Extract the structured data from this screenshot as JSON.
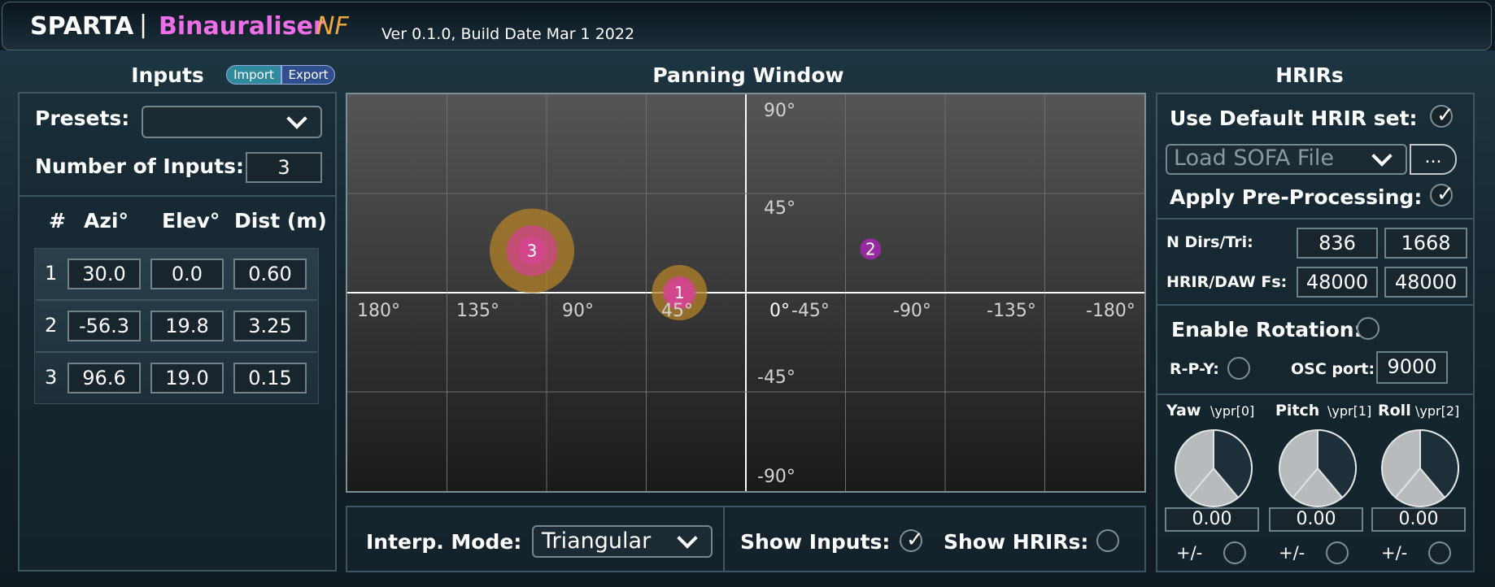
{
  "header": {
    "brand": "SPARTA",
    "divider": "|",
    "plugin_name": "Binauraliser",
    "plugin_suffix": "NF",
    "version": "Ver 0.1.0, Build Date Mar  1 2022"
  },
  "inputs": {
    "title": "Inputs",
    "import_label": "Import",
    "export_label": "Export",
    "presets_label": "Presets:",
    "presets_value": "",
    "num_inputs_label": "Number of Inputs:",
    "num_inputs_value": "3",
    "columns": [
      "#",
      "Azi°",
      "Elev°",
      "Dist (m)"
    ],
    "rows": [
      {
        "index": "1",
        "azi": "30.0",
        "elev": "0.0",
        "dist": "0.60"
      },
      {
        "index": "2",
        "azi": "-56.3",
        "elev": "19.8",
        "dist": "3.25"
      },
      {
        "index": "3",
        "azi": "96.6",
        "elev": "19.0",
        "dist": "0.15"
      }
    ]
  },
  "panning": {
    "title": "Panning Window",
    "elev_labels": [
      "90°",
      "45°",
      "-45°",
      "-90°"
    ],
    "azi_labels": [
      "180°",
      "135°",
      "90°",
      "45°",
      "0°",
      "-45°",
      "-90°",
      "-135°",
      "-180°"
    ],
    "sources": [
      {
        "id": "1",
        "azi": 30.0,
        "elev": 0.0,
        "dist": 0.6
      },
      {
        "id": "2",
        "azi": -56.3,
        "elev": 19.8,
        "dist": 3.25
      },
      {
        "id": "3",
        "azi": 96.6,
        "elev": 19.0,
        "dist": 0.15
      }
    ],
    "interp_label": "Interp. Mode:",
    "interp_value": "Triangular",
    "show_inputs_label": "Show Inputs:",
    "show_inputs_checked": true,
    "show_hrirs_label": "Show HRIRs:",
    "show_hrirs_checked": false
  },
  "hrirs": {
    "title": "HRIRs",
    "use_default_label": "Use Default HRIR set:",
    "use_default_checked": true,
    "sofa_placeholder": "Load SOFA File",
    "browse_label": "...",
    "preproc_label": "Apply Pre-Processing:",
    "preproc_checked": true,
    "ndirs_label": "N Dirs/Tri:",
    "ndirs_value": "836",
    "ntri_value": "1668",
    "fs_label": "HRIR/DAW Fs:",
    "hrir_fs": "48000",
    "daw_fs": "48000",
    "rotation_label": "Enable Rotation:",
    "rotation_enabled": false,
    "rpy_label": "R-P-Y:",
    "osc_label": "OSC port:",
    "osc_value": "9000",
    "knobs": [
      {
        "name": "Yaw",
        "osc": "\\ypr[0]",
        "value": "0.00",
        "flip_label": "+/-"
      },
      {
        "name": "Pitch",
        "osc": "\\ypr[1]",
        "value": "0.00",
        "flip_label": "+/-"
      },
      {
        "name": "Roll",
        "osc": "\\ypr[2]",
        "value": "0.00",
        "flip_label": "+/-"
      }
    ]
  },
  "colors": {
    "brand_pink": "#ee6ee6",
    "brand_orange": "#f0a83a",
    "import_bg": "#2f8a9c",
    "export_bg": "#2f4f8f",
    "source_inner": "#d2468c",
    "source_outer": "#b48228",
    "source_far": "#962a9e"
  }
}
